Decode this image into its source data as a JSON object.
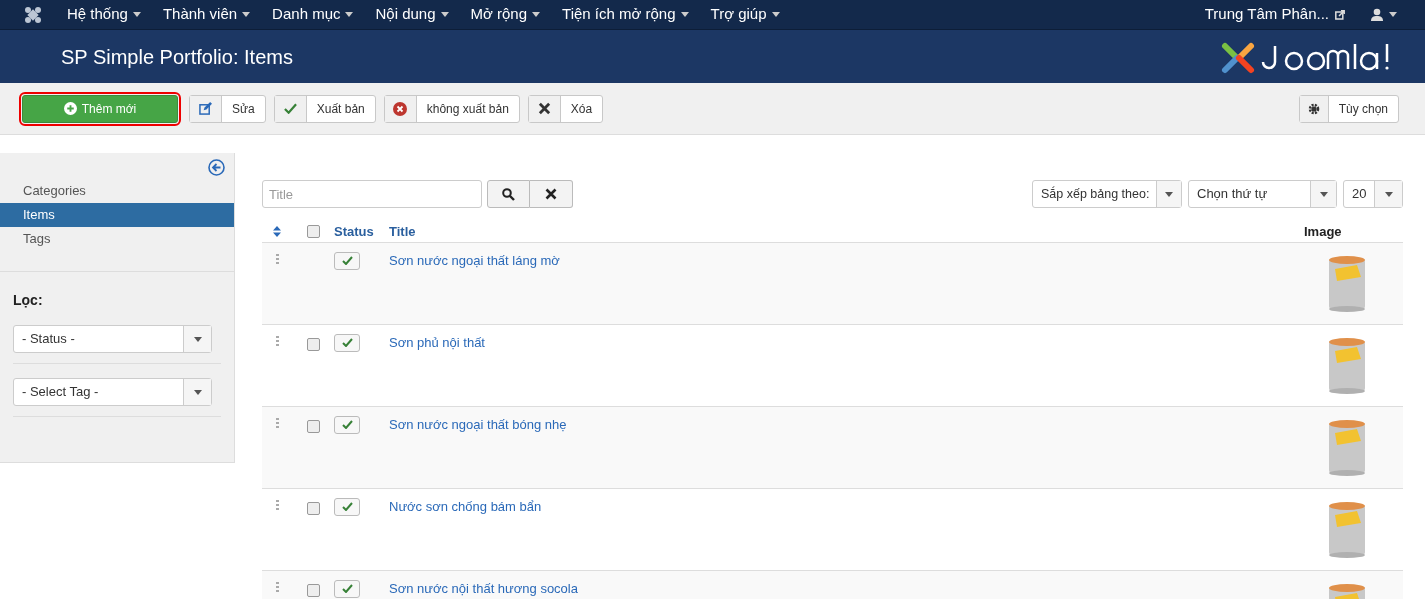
{
  "top_menu": {
    "items": [
      {
        "label": "Hệ thống"
      },
      {
        "label": "Thành viên"
      },
      {
        "label": "Danh mục"
      },
      {
        "label": "Nội dung"
      },
      {
        "label": "Mở rộng"
      },
      {
        "label": "Tiện ích mở rộng"
      },
      {
        "label": "Trợ giúp"
      }
    ],
    "site_link": "Trung Tâm Phân..."
  },
  "header": {
    "title": "SP Simple Portfolio: Items"
  },
  "toolbar": {
    "buttons": [
      {
        "kind": "add",
        "label": "Thêm mới",
        "highlighted": true
      },
      {
        "kind": "edit",
        "label": "Sửa",
        "highlighted": false
      },
      {
        "kind": "publish",
        "label": "Xuất bản",
        "highlighted": false
      },
      {
        "kind": "unpublish",
        "label": "không xuất bản",
        "highlighted": false
      },
      {
        "kind": "delete",
        "label": "Xóa",
        "highlighted": false
      }
    ],
    "options_label": "Tùy chọn"
  },
  "sidebar": {
    "items": [
      {
        "label": "Categories",
        "selected": false
      },
      {
        "label": "Items",
        "selected": true
      },
      {
        "label": "Tags",
        "selected": false
      }
    ],
    "filter_label": "Lọc:",
    "filters": [
      {
        "value": "- Status -"
      },
      {
        "value": "- Select Tag -"
      }
    ]
  },
  "search": {
    "placeholder": "Title"
  },
  "sort": {
    "order_by": "Sắp xếp bảng theo:",
    "direction": "Chọn thứ tự",
    "limit": "20"
  },
  "table": {
    "select_all_checked": false,
    "columns": [
      "Status",
      "Title",
      "Image"
    ],
    "rows": [
      {
        "title": "Sơn nước ngoại thất láng mờ",
        "published": true
      },
      {
        "title": "Sơn phủ nội thất",
        "published": true,
        "checked": false
      },
      {
        "title": "Sơn nước ngoại thất bóng nhẹ",
        "published": true,
        "checked": false
      },
      {
        "title": "Nước sơn chống bám bẩn",
        "published": true,
        "checked": false
      },
      {
        "title": "Sơn nước nội thất hương socola",
        "published": true,
        "checked": false
      }
    ]
  }
}
